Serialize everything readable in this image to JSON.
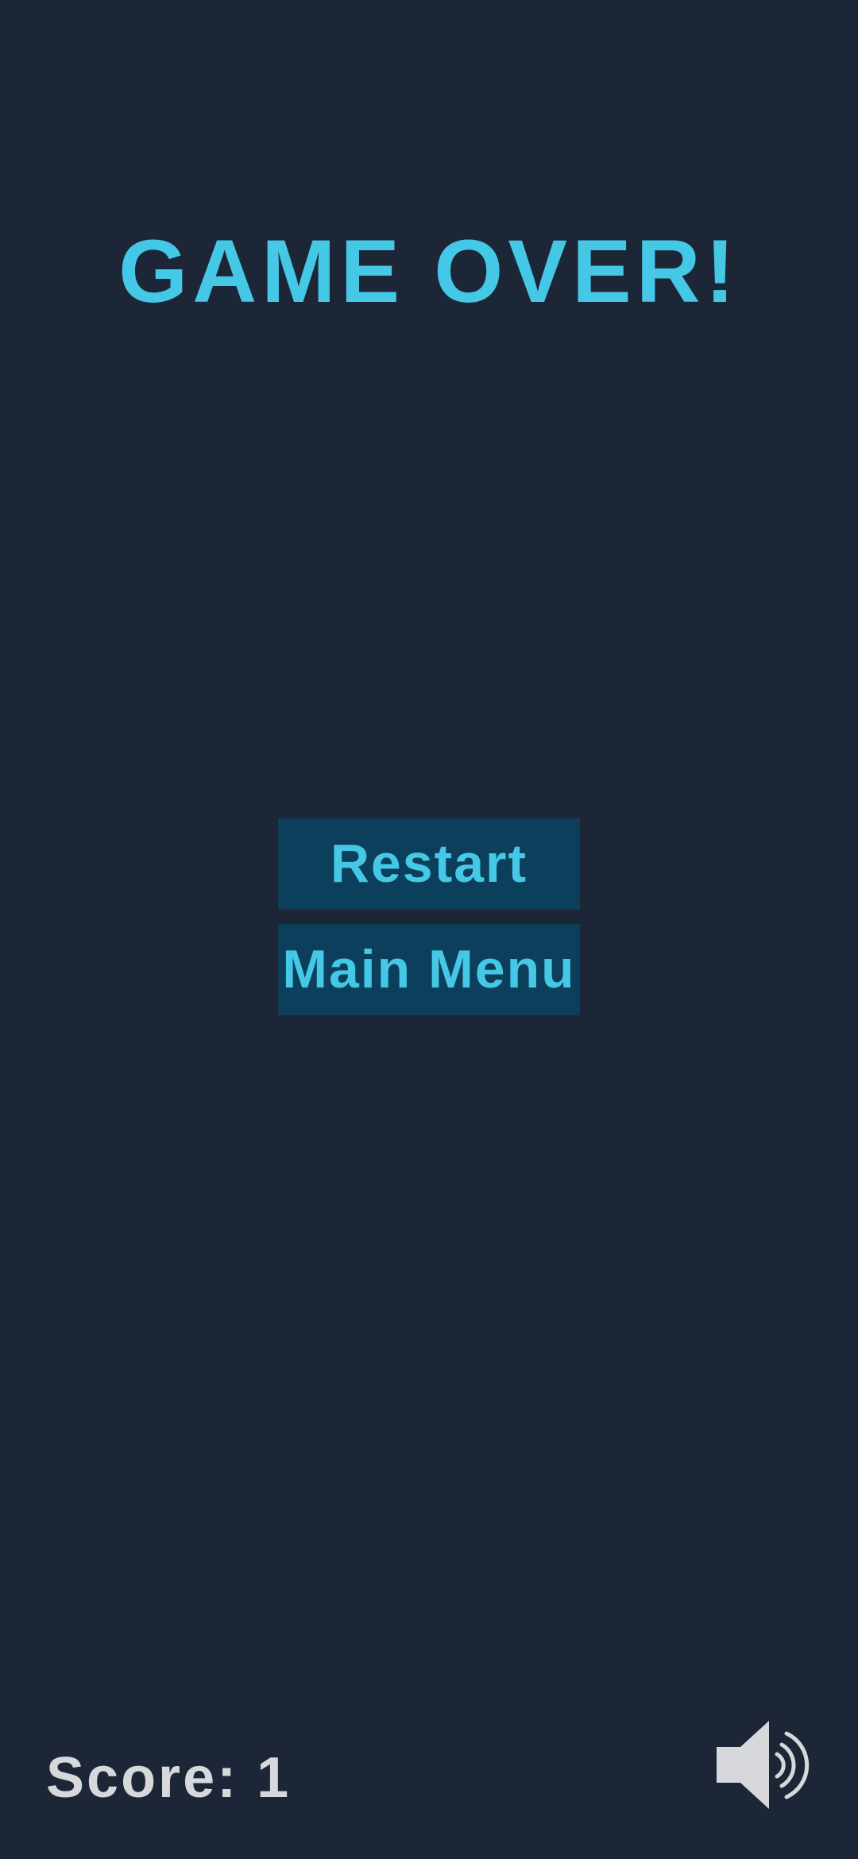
{
  "screen": {
    "title": "GAME OVER!",
    "background_color": "#1c2636",
    "accent_color": "#45c7e6"
  },
  "menu": {
    "restart_label": "Restart",
    "main_menu_label": "Main Menu",
    "button_color": "#0c3f5c"
  },
  "hud": {
    "score_text": "Score: 1",
    "sound_icon": "speaker-on-icon"
  }
}
